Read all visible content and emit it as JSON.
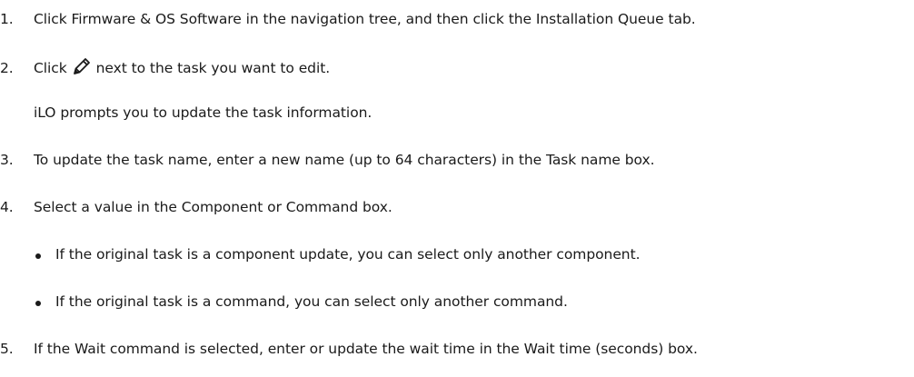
{
  "steps": [
    {
      "number": "1.",
      "text": "Click Firmware & OS Software  in the navigation tree, and then click the   Installation Queue tab."
    },
    {
      "number": "2.",
      "text_before_icon": "Click",
      "icon": "pencil-edit-icon",
      "text_after_icon": "next to the task you want to edit.",
      "note": "iLO prompts you to update the task information."
    },
    {
      "number": "3.",
      "text": "To update the task name, enter a new name (up to 64 characters) in the   Task name box."
    },
    {
      "number": "4.",
      "text": "Select a value in the  Component or  Command box.",
      "bullets": [
        "If the original task is a component update, you can select only another component.",
        "If the original task is a command, you can select only another command."
      ]
    },
    {
      "number": "5.",
      "text": "If the Wait command is selected, enter or update the wait time in the   Wait time (seconds) box."
    }
  ]
}
